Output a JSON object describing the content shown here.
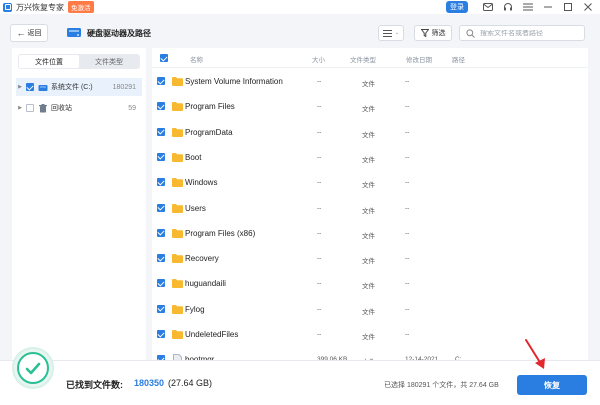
{
  "titlebar": {
    "app_name": "万兴恢复专家",
    "edition_badge": "免激活",
    "login_label": "登录",
    "icons": [
      "mail-icon",
      "headset-icon",
      "menu-icon",
      "minimize-icon",
      "maximize-icon",
      "close-icon"
    ]
  },
  "header": {
    "back_label": "返回",
    "title": "硬盘驱动器及路径",
    "filter_label": "筛选",
    "search_placeholder": "搜索文件名或者路径",
    "view_icon": "list-view-icon"
  },
  "sidebar": {
    "tabs": [
      {
        "label": "文件位置",
        "active": true
      },
      {
        "label": "文件类型",
        "active": false
      }
    ],
    "tree": [
      {
        "label": "系统文件 (C:)",
        "count": "180291",
        "checked": true,
        "icon": "drive-icon",
        "selected": true
      },
      {
        "label": "回收站",
        "count": "59",
        "checked": false,
        "icon": "recycle-bin-icon",
        "selected": false
      }
    ]
  },
  "table": {
    "columns": [
      "名称",
      "大小",
      "文件类型",
      "修改日期",
      "路径"
    ],
    "rows": [
      {
        "name": "System Volume Information",
        "size": "--",
        "type": "文件",
        "date": "--",
        "path": "",
        "kind": "folder"
      },
      {
        "name": "Program Files",
        "size": "--",
        "type": "文件",
        "date": "--",
        "path": "",
        "kind": "folder"
      },
      {
        "name": "ProgramData",
        "size": "--",
        "type": "文件",
        "date": "--",
        "path": "",
        "kind": "folder"
      },
      {
        "name": "Boot",
        "size": "--",
        "type": "文件",
        "date": "--",
        "path": "",
        "kind": "folder"
      },
      {
        "name": "Windows",
        "size": "--",
        "type": "文件",
        "date": "--",
        "path": "",
        "kind": "folder"
      },
      {
        "name": "Users",
        "size": "--",
        "type": "文件",
        "date": "--",
        "path": "",
        "kind": "folder"
      },
      {
        "name": "Program Files (x86)",
        "size": "--",
        "type": "文件",
        "date": "--",
        "path": "",
        "kind": "folder"
      },
      {
        "name": "Recovery",
        "size": "--",
        "type": "文件",
        "date": "--",
        "path": "",
        "kind": "folder"
      },
      {
        "name": "huguandaili",
        "size": "--",
        "type": "文件",
        "date": "--",
        "path": "",
        "kind": "folder"
      },
      {
        "name": "Fylog",
        "size": "--",
        "type": "文件",
        "date": "--",
        "path": "",
        "kind": "folder"
      },
      {
        "name": "UndeletedFiles",
        "size": "--",
        "type": "文件",
        "date": "--",
        "path": "",
        "kind": "folder"
      },
      {
        "name": "bootmgr",
        "size": "399.06 KB",
        "type": "文件",
        "date": "12-14-2021",
        "path": "C:",
        "kind": "file"
      }
    ]
  },
  "footer": {
    "found_label": "已找到文件数:",
    "found_count": "180350",
    "found_size": "(27.64 GB)",
    "selected_info": "已选择 180291 个文件，共 27.64 GB",
    "recover_label": "恢复"
  },
  "colors": {
    "accent": "#2a7de1",
    "success": "#2bbf94",
    "folder": "#f8b830",
    "annotation": "#e0282e"
  }
}
